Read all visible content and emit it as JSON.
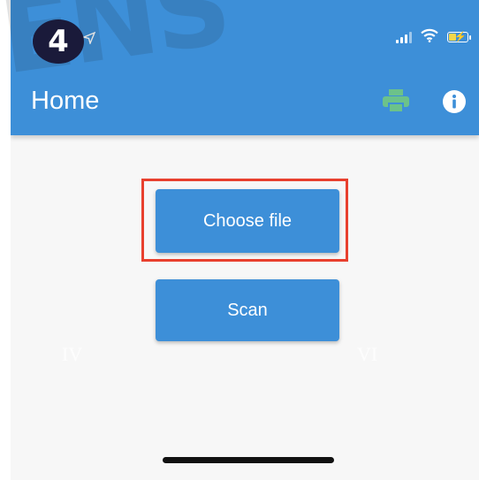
{
  "watermark": {
    "text": "ENS"
  },
  "step_badge": {
    "number": "4"
  },
  "header": {
    "title": "Home",
    "icons": {
      "print": "print-icon",
      "info": "info-icon"
    },
    "background_color": "#3d8fd8",
    "print_icon_color": "#6cc28a"
  },
  "status_bar": {
    "icons": [
      "location-arrow-icon",
      "cellular-signal-icon",
      "wifi-icon",
      "battery-charging-icon"
    ]
  },
  "main": {
    "choose_file_label": "Choose file",
    "scan_label": "Scan",
    "highlight_color": "#e8402e",
    "faint_labels": [
      "IV",
      "VI"
    ]
  }
}
